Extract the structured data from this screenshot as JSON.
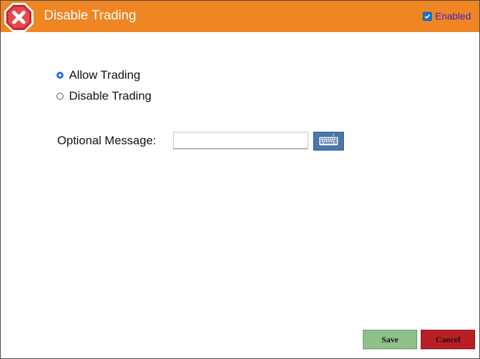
{
  "window": {
    "title": "Disable Trading",
    "icon": "stop-x-icon",
    "enabled_label": "Enabled",
    "enabled_checked": true
  },
  "trading_mode": {
    "options": [
      {
        "label": "Allow Trading",
        "checked": true
      },
      {
        "label": "Disable Trading",
        "checked": false
      }
    ]
  },
  "message": {
    "label": "Optional Message:",
    "value": "",
    "placeholder": "",
    "keyboard_icon": "keyboard-icon"
  },
  "footer": {
    "save_label": "Save",
    "cancel_label": "Cancel"
  },
  "colors": {
    "titlebar": "#f08523",
    "accent": "#1f6fd6",
    "save": "#8fbf8a",
    "cancel": "#b81f24",
    "keyboard_button": "#4a78b0"
  }
}
